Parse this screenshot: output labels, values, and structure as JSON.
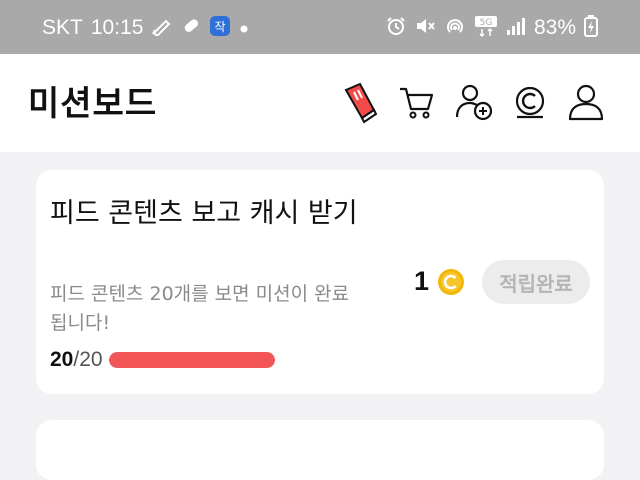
{
  "status_bar": {
    "carrier": "SKT",
    "time": "10:15",
    "battery": "83%",
    "network": "5G",
    "icons": [
      "pencil-icon",
      "pill-icon",
      "app-badge-icon",
      "dot-icon",
      "alarm-icon",
      "mute-icon",
      "hotspot-icon",
      "network-5g-icon",
      "signal-icon",
      "battery-charging-icon"
    ]
  },
  "header": {
    "title": "미션보드",
    "icons": [
      "sneaker-icon",
      "cart-icon",
      "add-friend-icon",
      "coin-history-icon",
      "profile-icon"
    ]
  },
  "mission": {
    "title": "피드 콘텐츠 보고 캐시 받기",
    "description": "피드 콘텐츠 20개를 보면 미션이 완료됩니다!",
    "progress_current": "20",
    "progress_total": "/20",
    "progress_fraction": 1.0,
    "reward_amount": "1",
    "reward_icon": "coin-icon",
    "status_label": "적립완료"
  },
  "colors": {
    "status_bar_bg": "#a9a9a9",
    "progress_fill": "#f25656",
    "coin": "#f2b705",
    "pill_bg": "#ececec",
    "pill_text": "#b5b5b5",
    "page_bg": "#f2f2f4"
  }
}
